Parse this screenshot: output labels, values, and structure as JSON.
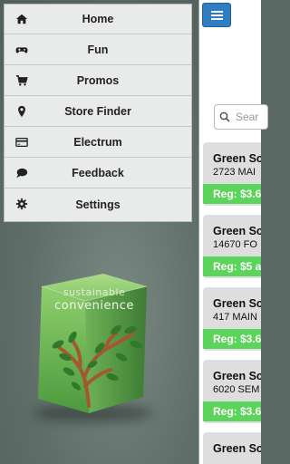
{
  "menu": {
    "items": [
      {
        "label": "Home",
        "icon": "home-icon"
      },
      {
        "label": "Fun",
        "icon": "gamepad-icon"
      },
      {
        "label": "Promos",
        "icon": "cart-icon"
      },
      {
        "label": "Store Finder",
        "icon": "map-marker-icon"
      },
      {
        "label": "Electrum",
        "icon": "credit-card-icon"
      },
      {
        "label": "Feedback",
        "icon": "comment-icon"
      },
      {
        "label": "Settings",
        "icon": "gear-icon"
      }
    ]
  },
  "logo": {
    "line1": "sustainable",
    "line2": "convenience"
  },
  "search": {
    "placeholder": "Sear"
  },
  "stores": [
    {
      "name": "Green Sc",
      "address": "2723 MAI",
      "price": "Reg: $3.6"
    },
    {
      "name": "Green Sc",
      "address": "14670 FO",
      "price": "Reg: $5 a"
    },
    {
      "name": "Green Sc",
      "address": "417 MAIN",
      "price": "Reg: $3.6"
    },
    {
      "name": "Green Sc",
      "address": "6020 SEM",
      "price": "Reg: $3.6"
    },
    {
      "name": "Green Sc",
      "address": "",
      "price": ""
    }
  ],
  "colors": {
    "accent": "#2f7ec2",
    "price_bar": "#5cd35a",
    "card": "#dedede",
    "menu_bg": "#e9ebea"
  }
}
